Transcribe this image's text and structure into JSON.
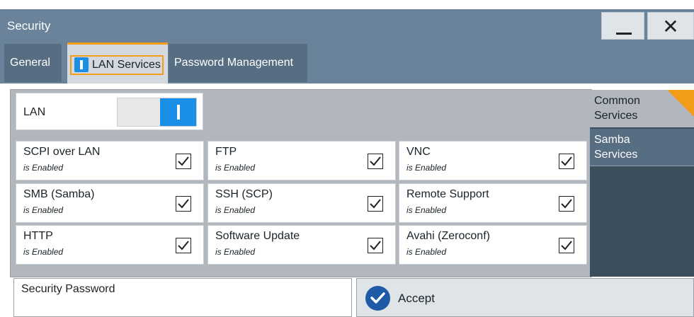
{
  "window": {
    "title": "Security",
    "minimize_icon": "minimize-icon",
    "close_icon": "close-icon",
    "close_glyph": "✕"
  },
  "tabs": [
    {
      "label": "General",
      "active": false
    },
    {
      "label": "LAN Services",
      "active": true
    },
    {
      "label": "Password Management",
      "active": false
    }
  ],
  "lan": {
    "label": "LAN",
    "enabled": true
  },
  "services": [
    {
      "name": "SCPI over LAN",
      "state": "is Enabled",
      "checked": true
    },
    {
      "name": "FTP",
      "state": "is Enabled",
      "checked": true
    },
    {
      "name": "VNC",
      "state": "is Enabled",
      "checked": true
    },
    {
      "name": "SMB (Samba)",
      "state": "is Enabled",
      "checked": true
    },
    {
      "name": "SSH (SCP)",
      "state": "is Enabled",
      "checked": true
    },
    {
      "name": "Remote Support",
      "state": "is Enabled",
      "checked": true
    },
    {
      "name": "HTTP",
      "state": "is Enabled",
      "checked": true
    },
    {
      "name": "Software Update",
      "state": "is Enabled",
      "checked": true
    },
    {
      "name": "Avahi (Zeroconf)",
      "state": "is Enabled",
      "checked": true
    }
  ],
  "side_nav": [
    {
      "label_line1": "Common",
      "label_line2": "Services",
      "active": true
    },
    {
      "label_line1": "Samba",
      "label_line2": "Services",
      "active": false
    }
  ],
  "security_password": {
    "label": "Security Password",
    "value": ""
  },
  "accept": {
    "label": "Accept",
    "icon": "check-circle-icon"
  },
  "colors": {
    "titlebar": "#6a829a",
    "accent": "#f39c1a",
    "toggle_on": "#1a8fe8",
    "panel": "#b1b7bd",
    "side_dark": "#3c4e5c"
  }
}
